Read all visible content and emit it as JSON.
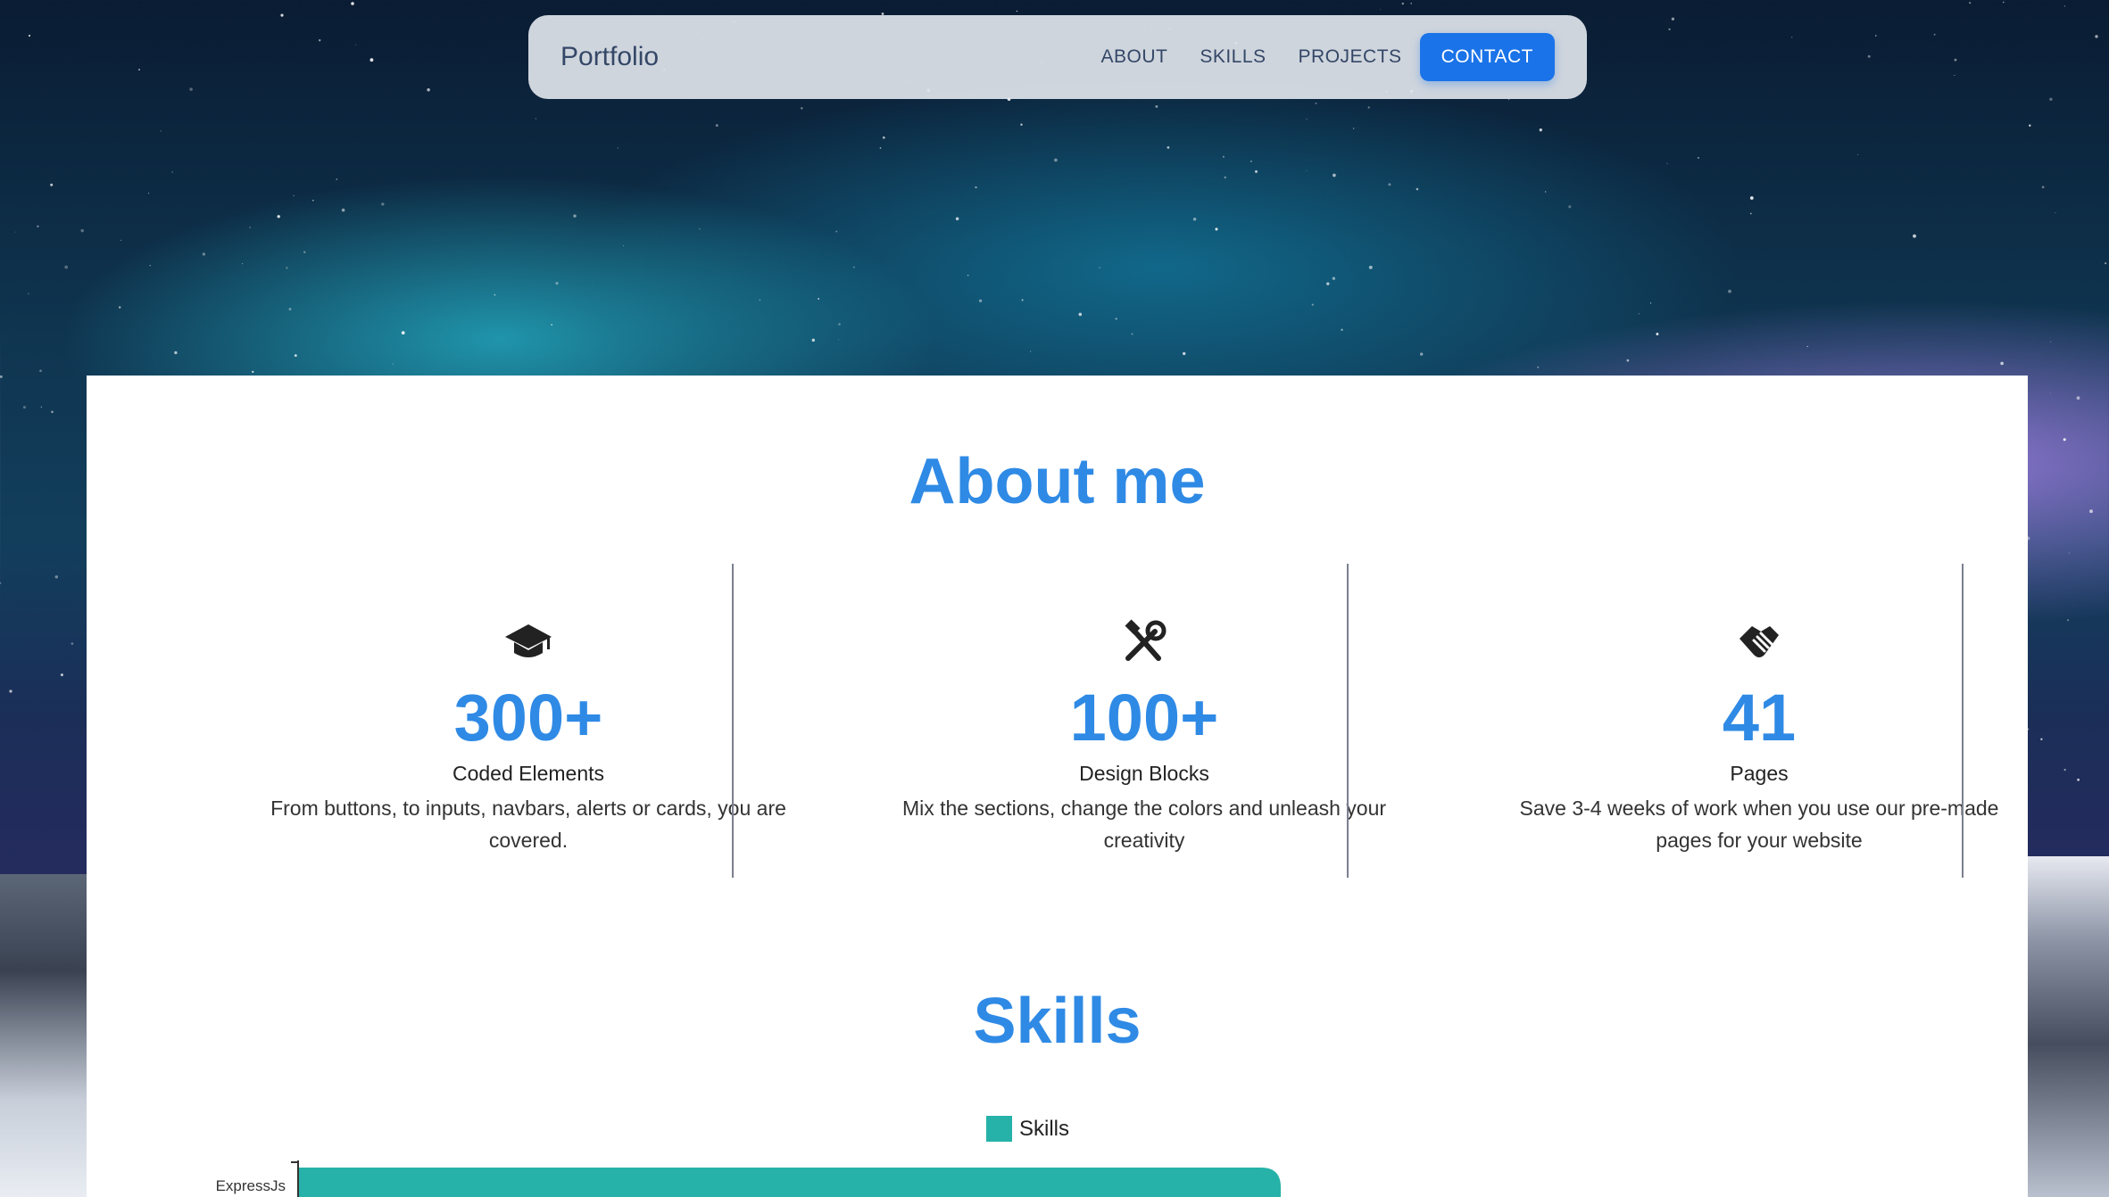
{
  "nav": {
    "brand": "Portfolio",
    "links": [
      "ABOUT",
      "SKILLS",
      "PROJECTS"
    ],
    "cta": "CONTACT"
  },
  "about": {
    "title": "About me",
    "stats": [
      {
        "icon": "graduation-cap-icon",
        "value": "300+",
        "label": "Coded Elements",
        "desc": "From buttons, to inputs, navbars, alerts or cards, you are covered."
      },
      {
        "icon": "tools-icon",
        "value": "100+",
        "label": "Design Blocks",
        "desc": "Mix the sections, change the colors and unleash your creativity"
      },
      {
        "icon": "handshake-icon",
        "value": "41",
        "label": "Pages",
        "desc": "Save 3-4 weeks of work when you use our pre-made pages for your website"
      }
    ]
  },
  "skills": {
    "title": "Skills"
  },
  "colors": {
    "accent": "#2f8ae5",
    "button": "#1a73e8",
    "bar": "#26b2a9"
  },
  "chart_data": {
    "type": "bar",
    "orientation": "horizontal",
    "categories": [
      "ExpressJs"
    ],
    "series": [
      {
        "name": "Skills",
        "values": [
          100
        ]
      }
    ],
    "legend": "top-center",
    "xlim": [
      0,
      100
    ]
  }
}
